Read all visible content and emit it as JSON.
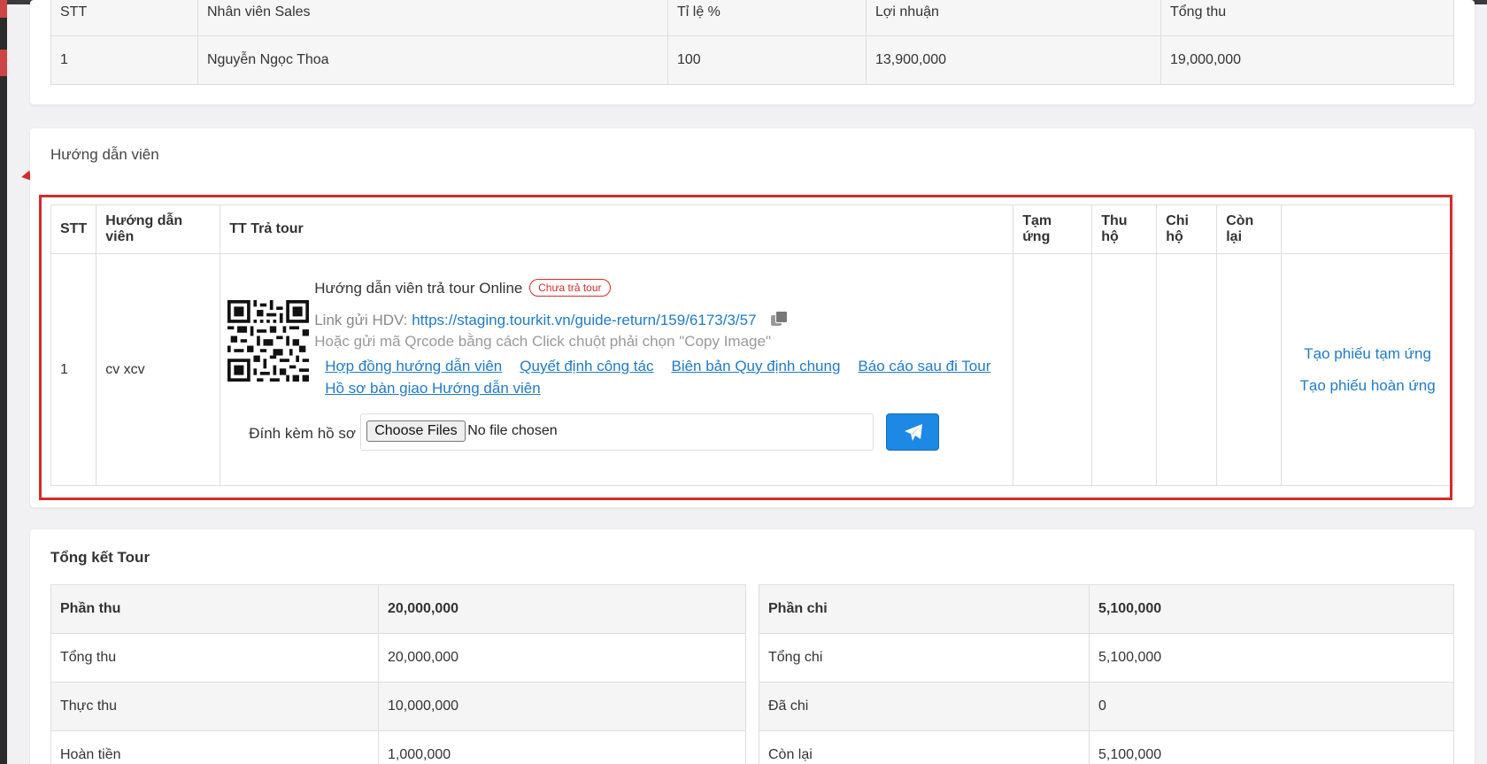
{
  "sales_table": {
    "headers": [
      "STT",
      "Nhân viên Sales",
      "Tỉ lệ %",
      "Lợi nhuận",
      "Tổng thu"
    ],
    "rows": [
      [
        "1",
        "Nguyễn Ngọc Thoa",
        "100",
        "13,900,000",
        "19,000,000"
      ]
    ]
  },
  "guide": {
    "title": "Hướng dẫn viên",
    "headers": [
      "STT",
      "Hướng dẫn viên",
      "TT Trả tour",
      "Tạm ứng",
      "Thu hộ",
      "Chi hộ",
      "Còn lại",
      ""
    ],
    "row": {
      "stt": "1",
      "name": "cv xcv",
      "online_title": "Hướng dẫn viên trả tour Online",
      "status_badge": "Chưa trả tour",
      "link_label": "Link gửi HDV:",
      "link_url": "https://staging.tourkit.vn/guide-return/159/6173/3/57",
      "qr_hint": "Hoặc gửi mã Qrcode bằng cách Click chuột phải chọn \"Copy Image\"",
      "doc_links": [
        "Hợp đồng hướng dẫn viên",
        "Quyết định công tác",
        "Biên bản Quy định chung",
        "Báo cáo sau đi Tour",
        "Hồ sơ bàn giao Hướng dẫn viên"
      ],
      "attach_label": "Đính kèm hồ sơ",
      "file_button": "Choose Files",
      "file_status": "No file chosen",
      "tam_ung": "",
      "thu_ho": "",
      "chi_ho": "",
      "con_lai": "",
      "actions": [
        "Tạo phiếu tạm ứng",
        "Tạo phiếu hoàn ứng"
      ]
    }
  },
  "summary": {
    "title": "Tổng kết Tour",
    "left": [
      [
        "Phần thu",
        "20,000,000"
      ],
      [
        "Tổng thu",
        "20,000,000"
      ],
      [
        "Thực thu",
        "10,000,000"
      ],
      [
        "Hoàn tiền",
        "1,000,000"
      ]
    ],
    "right": [
      [
        "Phần chi",
        "5,100,000"
      ],
      [
        "Tổng chi",
        "5,100,000"
      ],
      [
        "Đã chi",
        "0"
      ],
      [
        "Còn lại",
        "5,100,000"
      ]
    ]
  },
  "colors": {
    "highlight": "#d42b2b",
    "link": "#1f7ac9",
    "send_button": "#1e88e5"
  },
  "icons": {
    "copy": "copy-icon",
    "send": "paper-plane-icon",
    "qr": "qr-code-icon"
  }
}
